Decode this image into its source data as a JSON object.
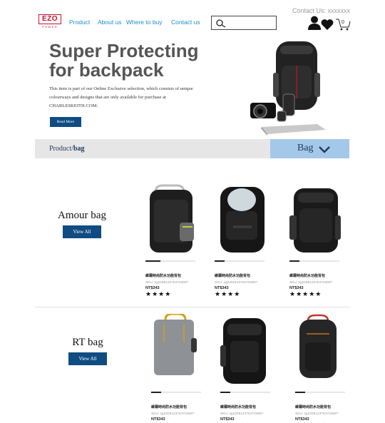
{
  "header": {
    "contact_text": "Contact Us: xxxxxxx",
    "logo_text": "EZO",
    "logo_sub": "POWER",
    "nav": [
      {
        "label": "Product"
      },
      {
        "label": "About us"
      },
      {
        "label": "Where to buy"
      },
      {
        "label": "Contact us"
      }
    ],
    "search_placeholder": "",
    "cart_count": "0"
  },
  "hero": {
    "title": "Super Protecting\nfor backpack",
    "description": "This item is part of our Online Exclusive selection, which consists of unique colourways and designs that are only available for purchase at CHARLESKEITH.COM.",
    "read_more_label": "Read More"
  },
  "breadcrumb": {
    "root": "Product/",
    "current": "bag",
    "dropdown_label": "Bag"
  },
  "categories": [
    {
      "title": "Amour bag",
      "view_all_label": "View All",
      "products": [
        {
          "name": "維爾時尚防水功能背包",
          "sku": "SKU: sg220612375470498?",
          "price": "NT$343",
          "stars": "★★★★",
          "progress": 0.3
        },
        {
          "name": "維爾時尚防水功能背包",
          "sku": "SKU: sg220612375470498?",
          "price": "NT$343",
          "stars": "★★★★",
          "progress": 0.2
        },
        {
          "name": "維爾時尚防水功能背包",
          "sku": "SKU: sg220612375470498?",
          "price": "NT$343",
          "stars": "★★★★★",
          "progress": 0.2
        }
      ]
    },
    {
      "title": "RT bag",
      "view_all_label": "View All",
      "products": [
        {
          "name": "維爾時尚防水功能背包",
          "sku": "SKU: sg220612375470498?",
          "price": "NT$343",
          "stars": "★★★★",
          "progress": 0.2
        },
        {
          "name": "維爾時尚防水功能背包",
          "sku": "SKU: sg220612375470498?",
          "price": "NT$343",
          "stars": "★★★★",
          "progress": 0.2
        },
        {
          "name": "維爾時尚防水功能背包",
          "sku": "SKU: sg220612375470498?",
          "price": "NT$343",
          "stars": "★★★★★",
          "progress": 0.2
        }
      ]
    }
  ],
  "colors": {
    "accent": "#0f4c81",
    "nav_link": "#1c8ccf",
    "dropdown_bg": "#a4c8e8",
    "logo": "#c8102e"
  },
  "icons": [
    "search-icon",
    "user-icon",
    "heart-icon",
    "cart-icon",
    "chevron-down-icon"
  ]
}
